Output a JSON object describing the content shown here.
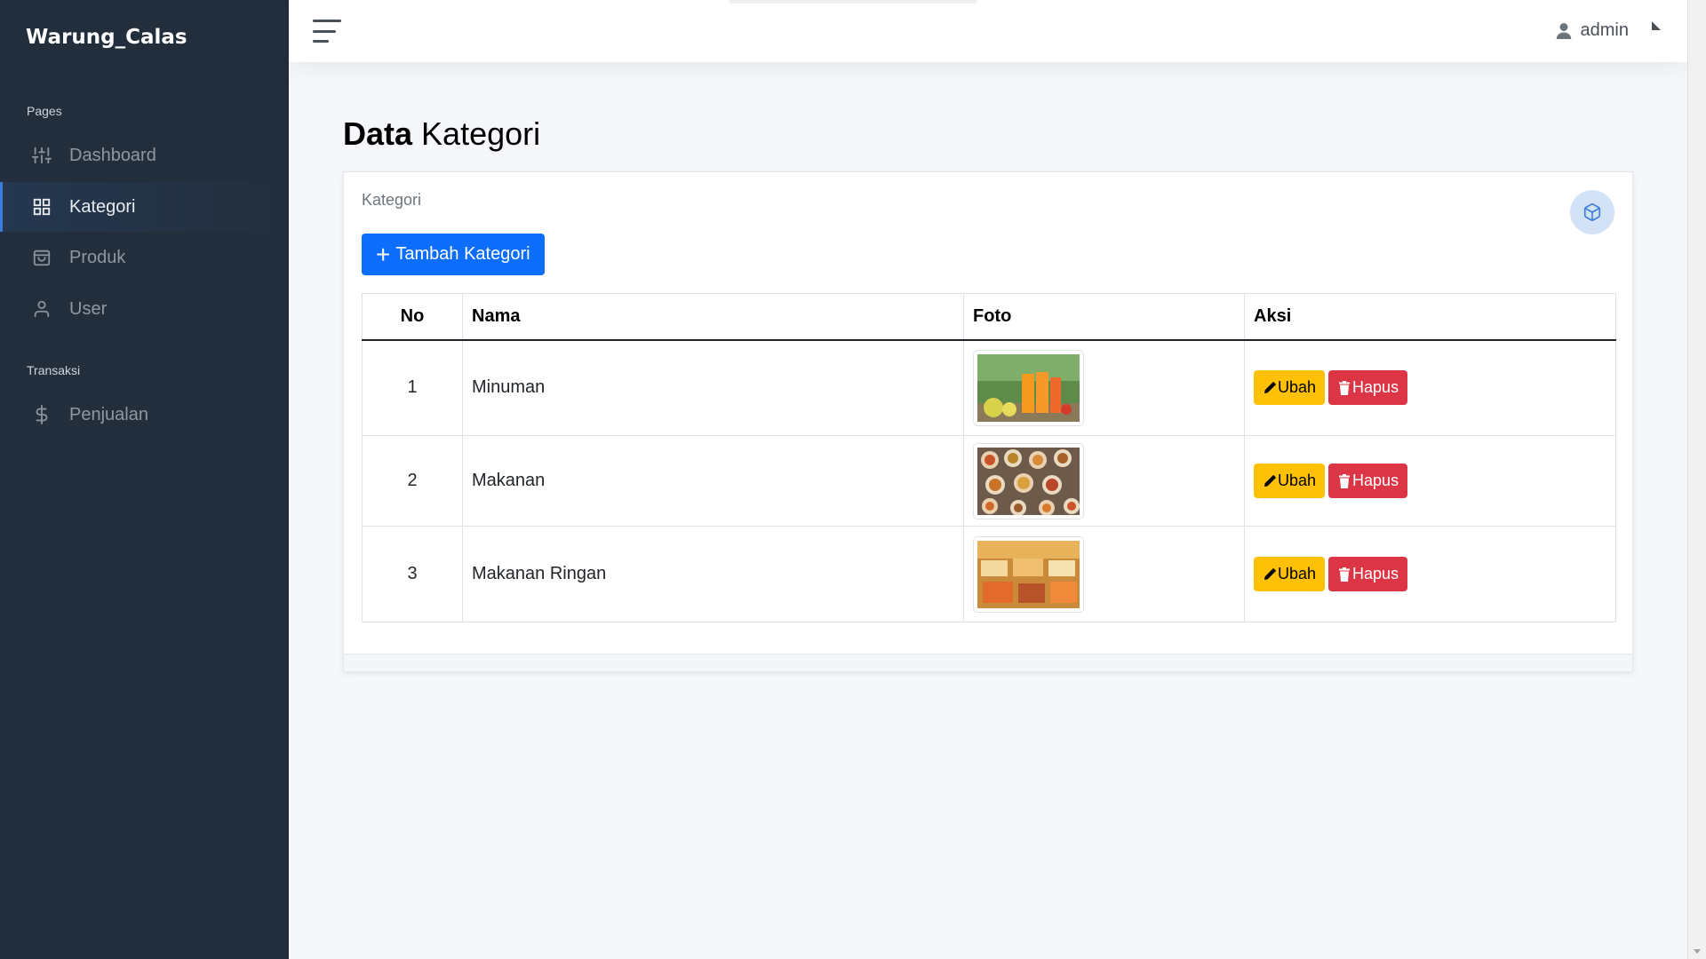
{
  "app": {
    "brand": "Warung_Calas"
  },
  "sidebar": {
    "sections": [
      {
        "header": "Pages"
      },
      {
        "header": "Transaksi"
      }
    ],
    "items": [
      {
        "label": "Dashboard",
        "icon": "sliders-icon",
        "active": false
      },
      {
        "label": "Kategori",
        "icon": "grid-icon",
        "active": true
      },
      {
        "label": "Produk",
        "icon": "shopping-bag-icon",
        "active": false
      },
      {
        "label": "User",
        "icon": "user-icon",
        "active": false
      },
      {
        "label": "Penjualan",
        "icon": "dollar-icon",
        "active": false
      }
    ]
  },
  "topbar": {
    "user_name": "admin"
  },
  "page": {
    "title_bold": "Data",
    "title_rest": " Kategori"
  },
  "card": {
    "title": "Kategori",
    "add_button": "Tambah Kategori",
    "columns": [
      "No",
      "Nama",
      "Foto",
      "Aksi"
    ],
    "rows": [
      {
        "no": "1",
        "nama": "Minuman",
        "foto": "minuman-photo"
      },
      {
        "no": "2",
        "nama": "Makanan",
        "foto": "makanan-photo"
      },
      {
        "no": "3",
        "nama": "Makanan Ringan",
        "foto": "makanan-ringan-photo"
      }
    ],
    "edit_label": "Ubah",
    "delete_label": "Hapus"
  },
  "colors": {
    "sidebar_bg": "#222e3c",
    "primary": "#0d6efd",
    "warning": "#ffc107",
    "danger": "#dc3545",
    "active_accent": "#3b7ddd"
  }
}
